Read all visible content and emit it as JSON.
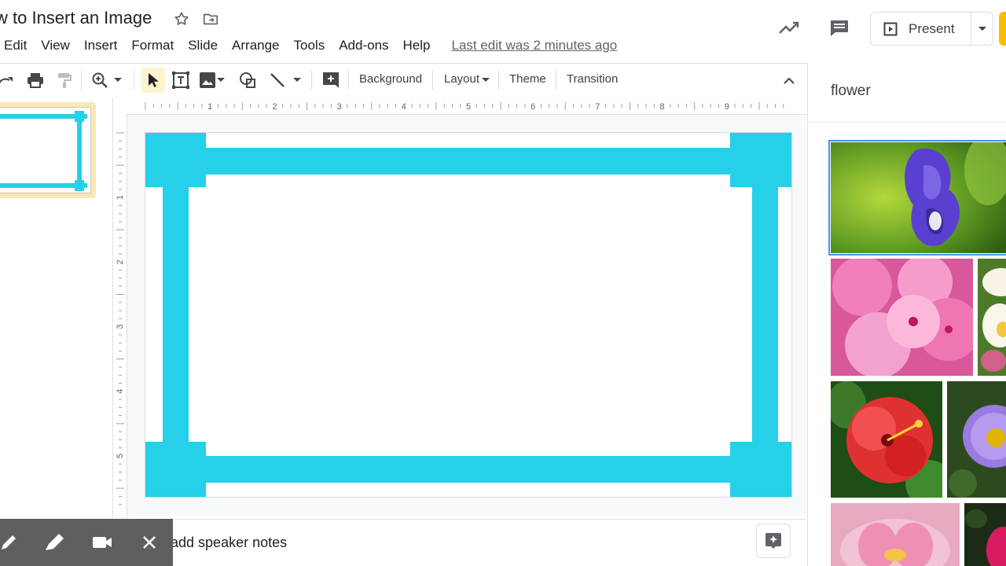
{
  "header": {
    "doc_title": "w to Insert an Image",
    "present_label": "Present"
  },
  "menu": {
    "items": [
      "Edit",
      "View",
      "Insert",
      "Format",
      "Slide",
      "Arrange",
      "Tools",
      "Add-ons",
      "Help"
    ],
    "last_edit": "Last edit was 2 minutes ago"
  },
  "toolbar": {
    "background_label": "Background",
    "layout_label": "Layout",
    "theme_label": "Theme",
    "transition_label": "Transition"
  },
  "rulers": {
    "top": [
      "1",
      "2",
      "3",
      "4",
      "5",
      "6",
      "7",
      "8",
      "9"
    ],
    "left": [
      "1",
      "2",
      "3",
      "4",
      "5"
    ]
  },
  "notes": {
    "placeholder": "o add speaker notes"
  },
  "image_search": {
    "query": "flower"
  },
  "colors": {
    "frame": "#25d0e8",
    "accent_selected": "#fce8b2",
    "brand_yellow": "#fbbc04"
  }
}
